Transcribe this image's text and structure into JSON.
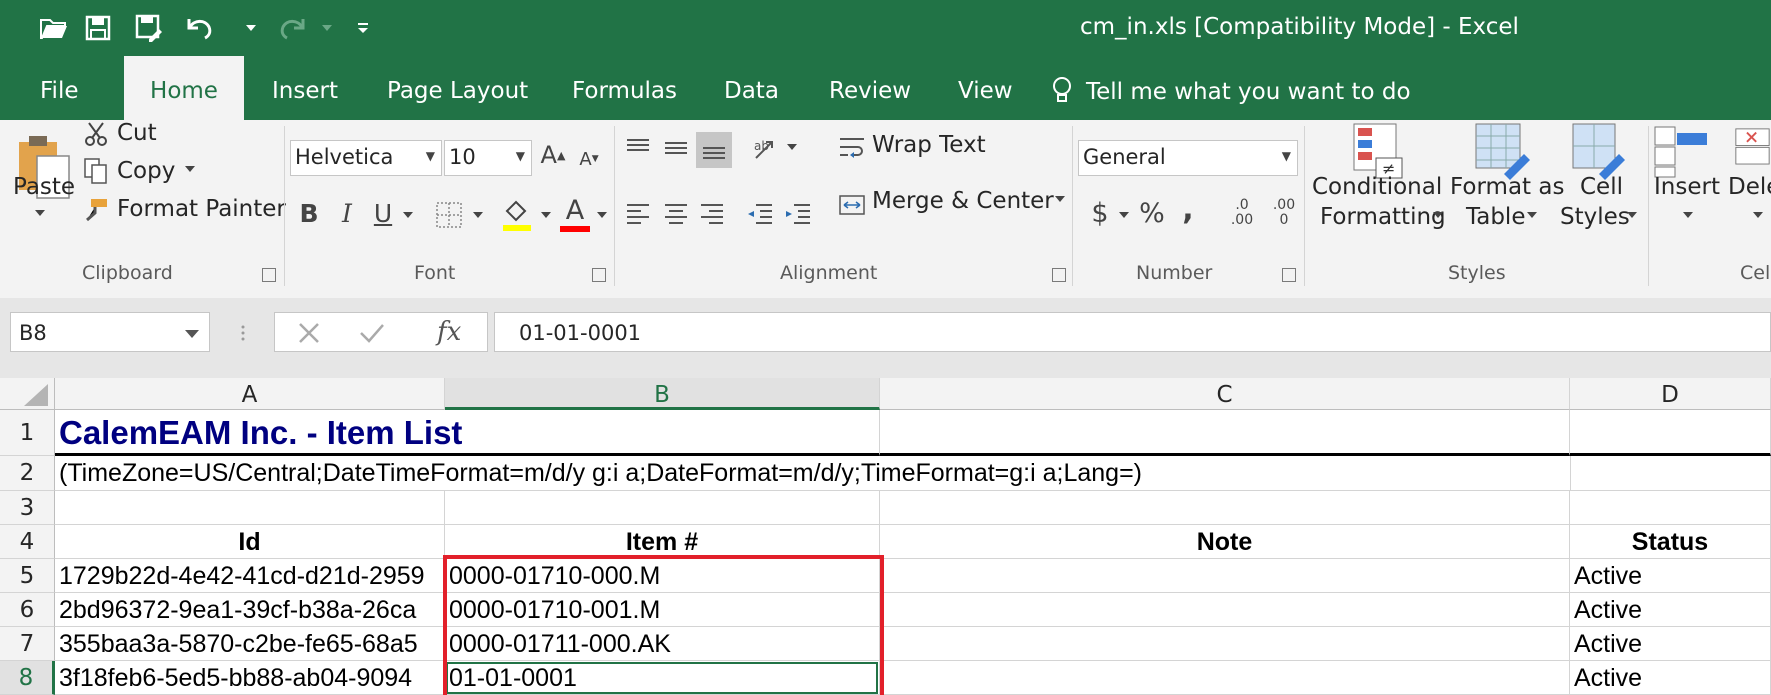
{
  "window": {
    "title": "cm_in.xls  [Compatibility Mode]  -  Excel"
  },
  "quick_access": [
    "open-icon",
    "save-icon",
    "save-as-icon",
    "undo-icon",
    "redo-icon",
    "customize-qat-icon"
  ],
  "tabs": [
    {
      "label": "File"
    },
    {
      "label": "Home"
    },
    {
      "label": "Insert"
    },
    {
      "label": "Page Layout"
    },
    {
      "label": "Formulas"
    },
    {
      "label": "Data"
    },
    {
      "label": "Review"
    },
    {
      "label": "View"
    }
  ],
  "tell_me": "Tell me what you want to do",
  "ribbon": {
    "clipboard": {
      "paste": "Paste",
      "cut": "Cut",
      "copy": "Copy",
      "format_painter": "Format Painter",
      "label": "Clipboard"
    },
    "font": {
      "name": "Helvetica",
      "size": "10",
      "label": "Font",
      "bold": "B",
      "italic": "I",
      "underline": "U",
      "font_color_glyph": "A",
      "fill_color": "#ffff00",
      "font_color": "#ff0000"
    },
    "alignment": {
      "wrap_text": "Wrap Text",
      "merge_center": "Merge & Center",
      "label": "Alignment"
    },
    "number": {
      "format": "General",
      "currency": "$",
      "percent": "%",
      "comma": ",",
      "label": "Number",
      "increase_decimal_top": ".0",
      "increase_decimal_bottom": ".00",
      "decrease_decimal_top": ".00",
      "decrease_decimal_bottom": "0"
    },
    "styles": {
      "conditional_1": "Conditional",
      "conditional_2": "Formatting",
      "table_1": "Format as",
      "table_2": "Table",
      "cell_1": "Cell",
      "cell_2": "Styles",
      "label": "Styles"
    },
    "cells": {
      "insert": "Insert",
      "delete": "Dele",
      "label": "Cel"
    }
  },
  "formula_bar": {
    "name_box": "B8",
    "fx": "fx",
    "value": "01-01-0001"
  },
  "columns": [
    {
      "label": "A",
      "selected": false
    },
    {
      "label": "B",
      "selected": true
    },
    {
      "label": "C",
      "selected": false
    },
    {
      "label": "D",
      "selected": false
    }
  ],
  "rows": [
    {
      "num": "1",
      "A": "CalemEAM Inc. - Item List",
      "B": "",
      "C": "",
      "D": ""
    },
    {
      "num": "2",
      "A": "(TimeZone=US/Central;DateTimeFormat=m/d/y g:i a;DateFormat=m/d/y;TimeFormat=g:i a;Lang=)",
      "B": "",
      "C": "",
      "D": ""
    },
    {
      "num": "3",
      "A": "",
      "B": "",
      "C": "",
      "D": ""
    },
    {
      "num": "4",
      "A": "Id",
      "B": "Item #",
      "C": "Note",
      "D": "Status"
    },
    {
      "num": "5",
      "A": "1729b22d-4e42-41cd-d21d-2959",
      "B": "0000-01710-000.M",
      "C": "",
      "D": "Active"
    },
    {
      "num": "6",
      "A": "2bd96372-9ea1-39cf-b38a-26ca",
      "B": "0000-01710-001.M",
      "C": "",
      "D": "Active"
    },
    {
      "num": "7",
      "A": "355baa3a-5870-c2be-fe65-68a5",
      "B": "0000-01711-000.AK",
      "C": "",
      "D": "Active"
    },
    {
      "num": "8",
      "A": "3f18feb6-5ed5-bb88-ab04-9094",
      "B": "01-01-0001",
      "C": "",
      "D": "Active"
    }
  ],
  "selected_cell": "B8",
  "highlight_color": "#e2202a",
  "accent": "#217346"
}
